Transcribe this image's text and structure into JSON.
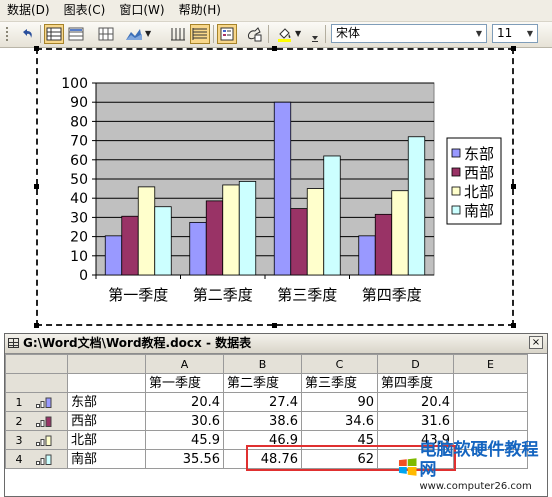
{
  "menu": [
    "数据(D)",
    "图表(C)",
    "窗口(W)",
    "帮助(H)"
  ],
  "toolbar": {
    "font": "宋体",
    "size": "11"
  },
  "chart_data": {
    "type": "bar",
    "categories": [
      "第一季度",
      "第二季度",
      "第三季度",
      "第四季度"
    ],
    "series": [
      {
        "name": "东部",
        "values": [
          20.4,
          27.4,
          90,
          20.4
        ],
        "color": "#9999ff"
      },
      {
        "name": "西部",
        "values": [
          30.6,
          38.6,
          34.6,
          31.6
        ],
        "color": "#993366"
      },
      {
        "name": "北部",
        "values": [
          45.9,
          46.9,
          45,
          43.9
        ],
        "color": "#ffffcc"
      },
      {
        "name": "南部",
        "values": [
          35.56,
          48.76,
          62,
          72
        ],
        "color": "#ccffff"
      }
    ],
    "yticks": [
      "0",
      "10",
      "20",
      "30",
      "40",
      "50",
      "60",
      "70",
      "80",
      "90",
      "100"
    ],
    "ylim": [
      0,
      100
    ],
    "plot_bg": "#c0c0c0",
    "legend_position": "right",
    "grid": true
  },
  "datasheet": {
    "title": "G:\\Word文档\\Word教程.docx - 数据表",
    "close": "×",
    "columns": [
      "",
      "A",
      "B",
      "C",
      "D",
      "E"
    ],
    "header_row": [
      "",
      "第一季度",
      "第二季度",
      "第三季度",
      "第四季度",
      ""
    ],
    "rows": [
      {
        "num": "1",
        "label": "东部",
        "values": [
          "20.4",
          "27.4",
          "90",
          "20.4"
        ],
        "color": "#9999ff"
      },
      {
        "num": "2",
        "label": "西部",
        "values": [
          "30.6",
          "38.6",
          "34.6",
          "31.6"
        ],
        "color": "#993366"
      },
      {
        "num": "3",
        "label": "北部",
        "values": [
          "45.9",
          "46.9",
          "45",
          "43.9"
        ],
        "color": "#ffffcc"
      },
      {
        "num": "4",
        "label": "南部",
        "values": [
          "35.56",
          "48.76",
          "62",
          ""
        ],
        "color": "#ccffff"
      }
    ]
  },
  "watermark": {
    "title": "电脑软硬件教程网",
    "url": "www.computer26.com"
  }
}
